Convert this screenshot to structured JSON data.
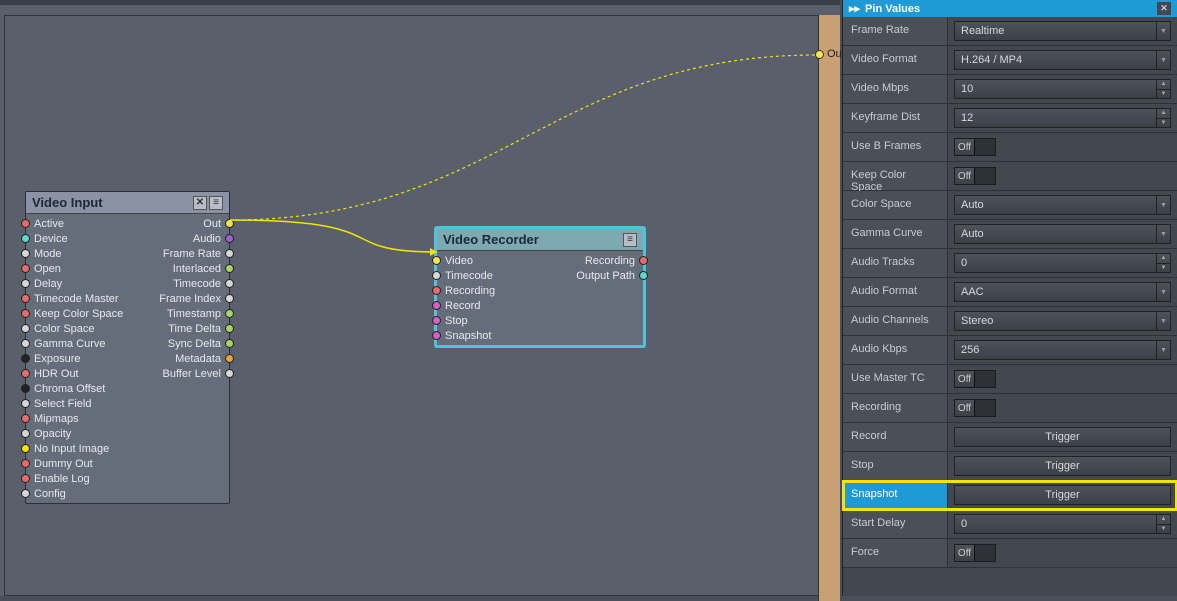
{
  "canvas": {
    "out_label": "Out"
  },
  "node_input": {
    "title": "Video Input",
    "left_pins": [
      {
        "label": "Active",
        "color": "#e86a6a"
      },
      {
        "label": "Device",
        "color": "#5fd6c9"
      },
      {
        "label": "Mode",
        "color": "#d6d6d6"
      },
      {
        "label": "Open",
        "color": "#e86a6a"
      },
      {
        "label": "Delay",
        "color": "#d6d6d6"
      },
      {
        "label": "Timecode Master",
        "color": "#e86a6a"
      },
      {
        "label": "Keep Color Space",
        "color": "#e86a6a"
      },
      {
        "label": "Color Space",
        "color": "#d6d6d6"
      },
      {
        "label": "Gamma Curve",
        "color": "#d6d6d6"
      },
      {
        "label": "Exposure",
        "color": "#222222"
      },
      {
        "label": "HDR Out",
        "color": "#e86a6a"
      },
      {
        "label": "Chroma Offset",
        "color": "#222222"
      },
      {
        "label": "Select Field",
        "color": "#d6d6d6"
      },
      {
        "label": "Mipmaps",
        "color": "#e86a6a"
      },
      {
        "label": "Opacity",
        "color": "#d6d6d6"
      },
      {
        "label": "No Input Image",
        "color": "#f5e400"
      },
      {
        "label": "Dummy Out",
        "color": "#e86a6a"
      },
      {
        "label": "Enable Log",
        "color": "#e86a6a"
      },
      {
        "label": "Config",
        "color": "#d6d6d6"
      }
    ],
    "right_pins": [
      {
        "label": "Out",
        "color": "#f1e24a"
      },
      {
        "label": "Audio",
        "color": "#a05fd6"
      },
      {
        "label": "Frame Rate",
        "color": "#d6d6d6"
      },
      {
        "label": "Interlaced",
        "color": "#a5d65f"
      },
      {
        "label": "Timecode",
        "color": "#d6d6d6"
      },
      {
        "label": "Frame Index",
        "color": "#d6d6d6"
      },
      {
        "label": "Timestamp",
        "color": "#a5d65f"
      },
      {
        "label": "Time Delta",
        "color": "#a5d65f"
      },
      {
        "label": "Sync Delta",
        "color": "#a5d65f"
      },
      {
        "label": "Metadata",
        "color": "#e8a23c"
      },
      {
        "label": "Buffer Level",
        "color": "#d6d6d6"
      }
    ]
  },
  "node_recorder": {
    "title": "Video Recorder",
    "left_pins": [
      {
        "label": "Video",
        "color": "#f1e24a"
      },
      {
        "label": "Timecode",
        "color": "#d6d6d6"
      },
      {
        "label": "Recording",
        "color": "#e86a6a"
      },
      {
        "label": "Record",
        "color": "#d65fc5"
      },
      {
        "label": "Stop",
        "color": "#d65fc5"
      },
      {
        "label": "Snapshot",
        "color": "#d65fc5"
      }
    ],
    "right_pins": [
      {
        "label": "Recording",
        "color": "#e86a6a"
      },
      {
        "label": "Output Path",
        "color": "#5fd6c9"
      }
    ]
  },
  "panel": {
    "title": "Pin Values",
    "rows": [
      {
        "label": "Frame Rate",
        "type": "select",
        "value": "Realtime"
      },
      {
        "label": "Video Format",
        "type": "select",
        "value": "H.264 / MP4"
      },
      {
        "label": "Video Mbps",
        "type": "num",
        "value": "10"
      },
      {
        "label": "Keyframe Dist",
        "type": "num",
        "value": "12"
      },
      {
        "label": "Use B Frames",
        "type": "toggle",
        "value": "Off"
      },
      {
        "label": "Keep Color Space",
        "type": "toggle",
        "value": "Off"
      },
      {
        "label": "Color Space",
        "type": "select",
        "value": "Auto"
      },
      {
        "label": "Gamma Curve",
        "type": "select",
        "value": "Auto"
      },
      {
        "label": "Audio Tracks",
        "type": "num",
        "value": "0"
      },
      {
        "label": "Audio Format",
        "type": "select",
        "value": "AAC"
      },
      {
        "label": "Audio Channels",
        "type": "select",
        "value": "Stereo"
      },
      {
        "label": "Audio Kbps",
        "type": "select",
        "value": "256"
      },
      {
        "label": "Use Master TC",
        "type": "toggle",
        "value": "Off"
      },
      {
        "label": "Recording",
        "type": "toggle",
        "value": "Off"
      },
      {
        "label": "Record",
        "type": "trigger",
        "value": "Trigger"
      },
      {
        "label": "Stop",
        "type": "trigger",
        "value": "Trigger"
      },
      {
        "label": "Snapshot",
        "type": "trigger",
        "value": "Trigger",
        "highlight": true
      },
      {
        "label": "Start Delay",
        "type": "num",
        "value": "0"
      },
      {
        "label": "Force",
        "type": "toggle",
        "value": "Off"
      }
    ]
  }
}
